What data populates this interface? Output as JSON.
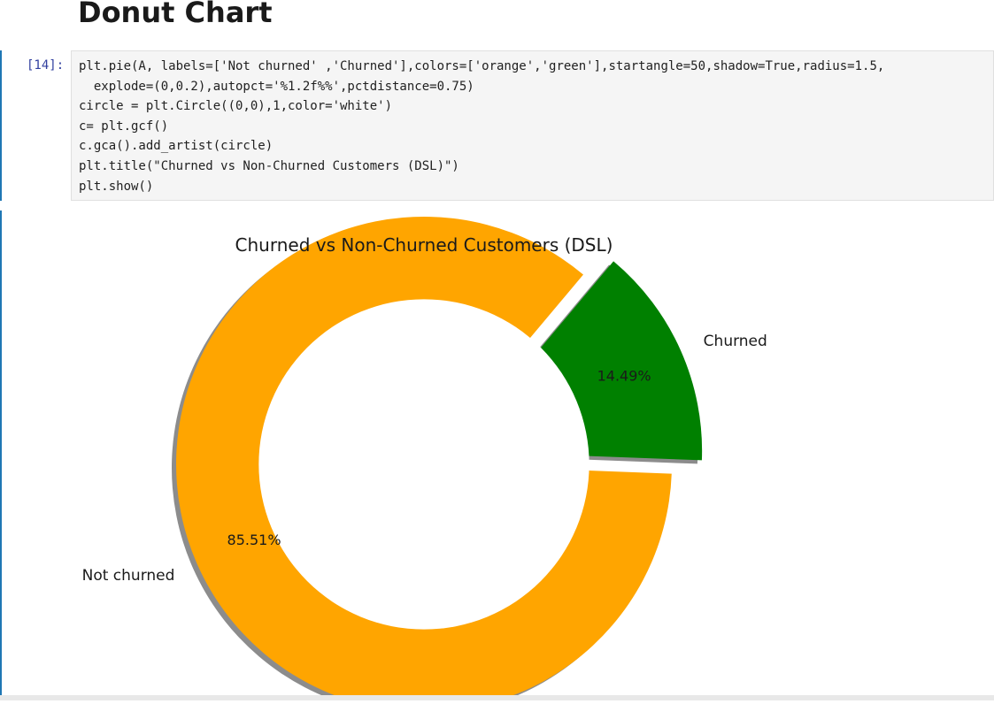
{
  "page": {
    "heading": "Donut Chart"
  },
  "cell": {
    "prompt": "[14]:",
    "code_lines": [
      "plt.pie(A, labels=['Not churned' ,'Churned'],colors=['orange','green'],startangle=50,shadow=True,radius=1.5,",
      "  explode=(0,0.2),autopct='%1.2f%%',pctdistance=0.75)",
      "circle = plt.Circle((0,0),1,color='white')",
      "c= plt.gcf()",
      "c.gca().add_artist(circle)",
      "plt.title(\"Churned vs Non-Churned Customers (DSL)\")",
      "plt.show()"
    ]
  },
  "chart_data": {
    "type": "pie",
    "title": "Churned vs Non-Churned Customers (DSL)",
    "labels": [
      "Not churned",
      "Churned"
    ],
    "values": [
      85.51,
      14.49
    ],
    "value_labels": [
      "85.51%",
      "14.49%"
    ],
    "colors": [
      "#ffa500",
      "#008000"
    ],
    "startangle": 50,
    "explode": [
      0,
      0.2
    ],
    "donut_hole": true,
    "shadow": true
  }
}
